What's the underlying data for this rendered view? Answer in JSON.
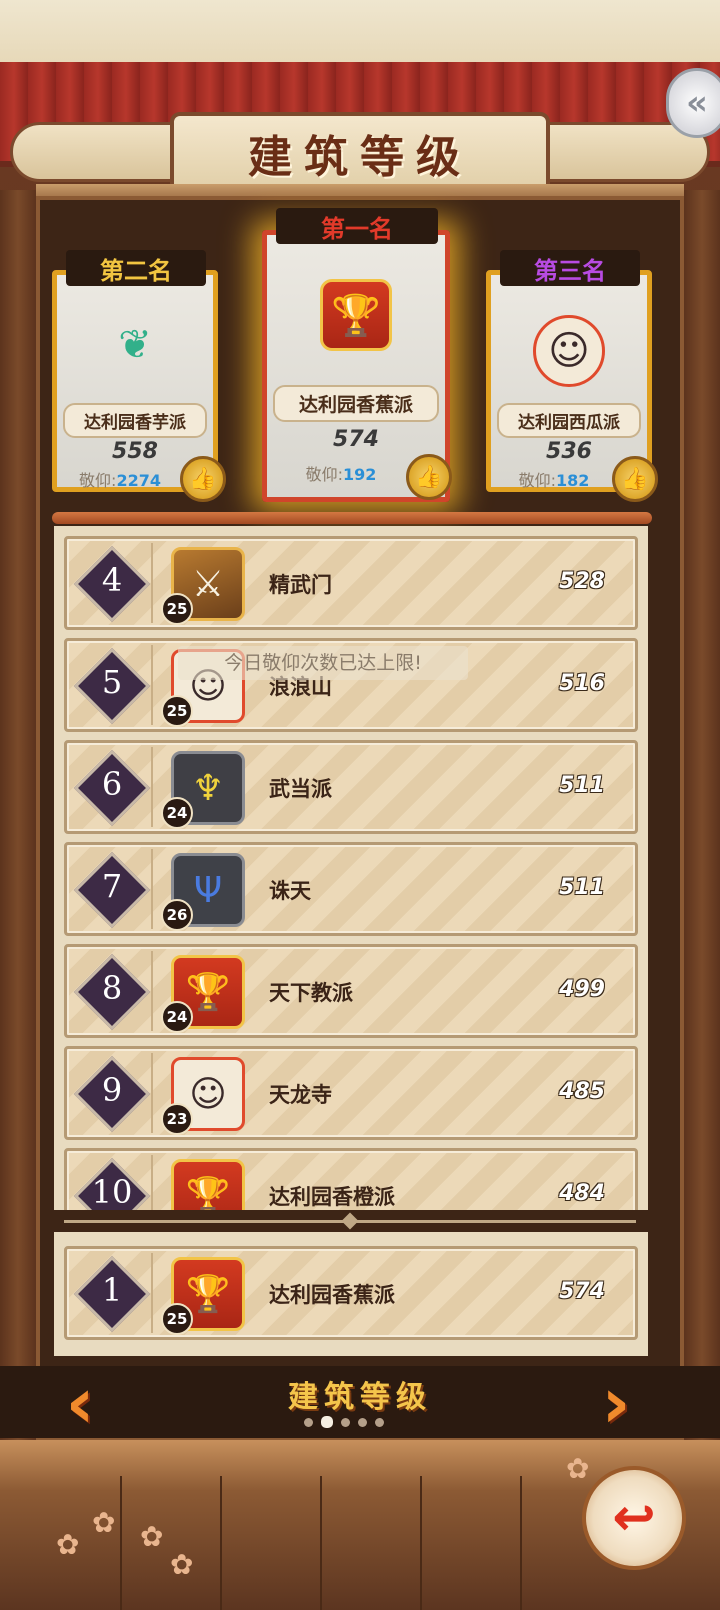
{
  "header": {
    "title": "建筑等级",
    "back_icon": "double-chevron-left-icon"
  },
  "podium": {
    "first": {
      "rank_label": "第一名",
      "name": "达利园香蕉派",
      "score": "574",
      "respect_label": "敬仰:",
      "respect_value": "192",
      "emblem": "trophy-emblem"
    },
    "second": {
      "rank_label": "第二名",
      "name": "达利园香芋派",
      "score": "558",
      "respect_label": "敬仰:",
      "respect_value": "2274",
      "emblem": "green-flame-emblem"
    },
    "third": {
      "rank_label": "第三名",
      "name": "达利园西瓜派",
      "score": "536",
      "respect_label": "敬仰:",
      "respect_value": "182",
      "emblem": "lion-dance-girl-emblem"
    }
  },
  "toast": "今日敬仰次数已达上限!",
  "rankings": [
    {
      "rank": "4",
      "level": "25",
      "name": "精武门",
      "score": "528",
      "emblem": "swords-emblem"
    },
    {
      "rank": "5",
      "level": "25",
      "name": "浪浪山",
      "score": "516",
      "emblem": "lion-dance-girl-emblem"
    },
    {
      "rank": "6",
      "level": "24",
      "name": "武当派",
      "score": "511",
      "emblem": "yellow-crest-emblem"
    },
    {
      "rank": "7",
      "level": "26",
      "name": "诛天",
      "score": "511",
      "emblem": "blue-trident-emblem"
    },
    {
      "rank": "8",
      "level": "24",
      "name": "天下教派",
      "score": "499",
      "emblem": "trophy-emblem"
    },
    {
      "rank": "9",
      "level": "23",
      "name": "天龙寺",
      "score": "485",
      "emblem": "lion-dance-girl-emblem"
    },
    {
      "rank": "10",
      "level": "",
      "name": "达利园香橙派",
      "score": "484",
      "emblem": "trophy-emblem"
    }
  ],
  "my_rank": {
    "rank": "1",
    "level": "25",
    "name": "达利园香蕉派",
    "score": "574",
    "emblem": "trophy-emblem"
  },
  "bottom_nav": {
    "title": "建筑等级",
    "page_count": 5,
    "active_page": 2
  },
  "colors": {
    "curtain": "#9b2a22",
    "first_place": "#e23a2a",
    "second_place": "#f2c541",
    "third_place": "#b84be2",
    "respect_value": "#2b8fd6"
  }
}
